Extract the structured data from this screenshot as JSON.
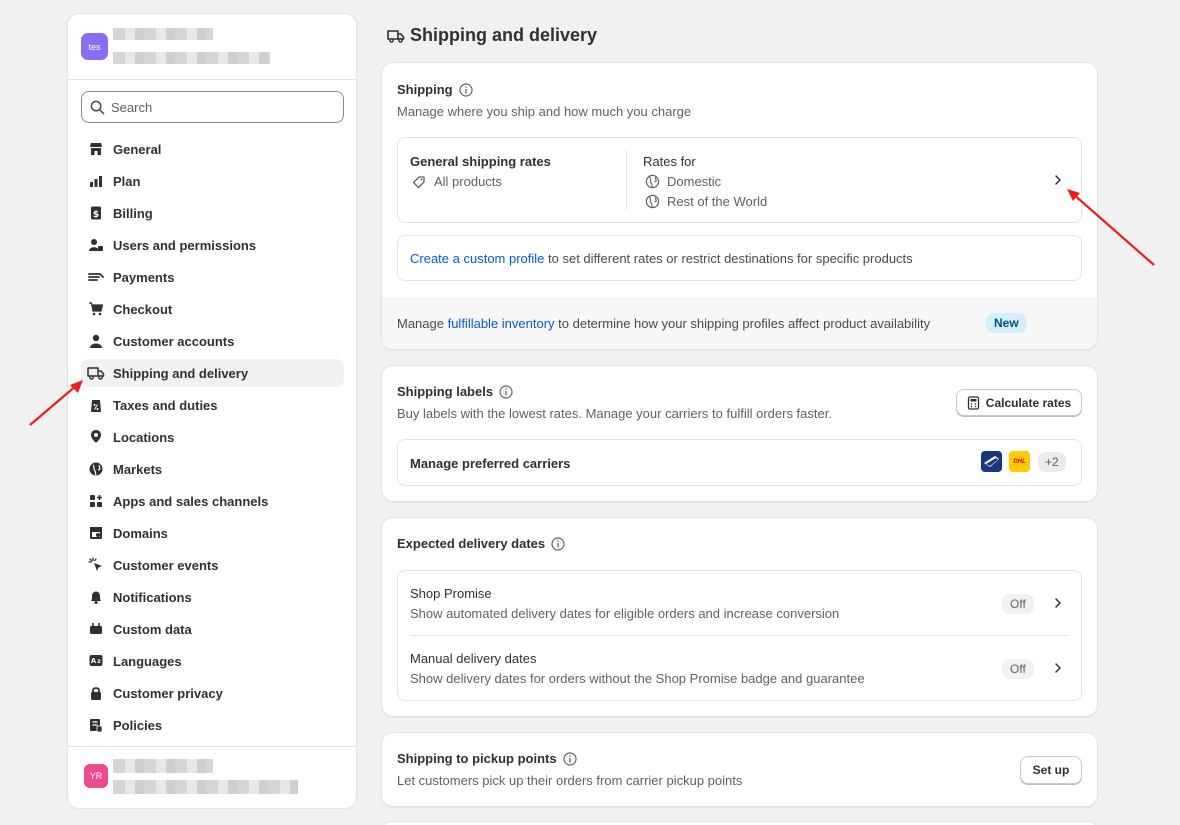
{
  "sidebar": {
    "store_avatar": "tes",
    "search_placeholder": "Search",
    "items": [
      {
        "label": "General",
        "icon": "store-icon"
      },
      {
        "label": "Plan",
        "icon": "plan-icon"
      },
      {
        "label": "Billing",
        "icon": "billing-icon"
      },
      {
        "label": "Users and permissions",
        "icon": "users-icon"
      },
      {
        "label": "Payments",
        "icon": "payments-icon"
      },
      {
        "label": "Checkout",
        "icon": "cart-icon"
      },
      {
        "label": "Customer accounts",
        "icon": "person-icon"
      },
      {
        "label": "Shipping and delivery",
        "icon": "truck-icon",
        "active": true
      },
      {
        "label": "Taxes and duties",
        "icon": "tax-icon"
      },
      {
        "label": "Locations",
        "icon": "location-icon"
      },
      {
        "label": "Markets",
        "icon": "globe-icon"
      },
      {
        "label": "Apps and sales channels",
        "icon": "apps-icon"
      },
      {
        "label": "Domains",
        "icon": "domains-icon"
      },
      {
        "label": "Customer events",
        "icon": "cursor-icon"
      },
      {
        "label": "Notifications",
        "icon": "bell-icon"
      },
      {
        "label": "Custom data",
        "icon": "data-icon"
      },
      {
        "label": "Languages",
        "icon": "language-icon"
      },
      {
        "label": "Customer privacy",
        "icon": "lock-icon"
      },
      {
        "label": "Policies",
        "icon": "policies-icon"
      }
    ],
    "user_avatar": "YR"
  },
  "page": {
    "title": "Shipping and delivery"
  },
  "shipping": {
    "title": "Shipping",
    "subtitle": "Manage where you ship and how much you charge",
    "general_rates_title": "General shipping rates",
    "all_products": "All products",
    "rates_for": "Rates for",
    "domestic": "Domestic",
    "rest_of_world": "Rest of the World",
    "custom_profile_link": "Create a custom profile",
    "custom_profile_text": " to set different rates or restrict destinations for specific products",
    "footer_prefix": "Manage ",
    "footer_link": "fulfillable inventory",
    "footer_suffix": " to determine how your shipping profiles affect product availability",
    "new_badge": "New"
  },
  "labels": {
    "title": "Shipping labels",
    "subtitle": "Buy labels with the lowest rates. Manage your carriers to fulfill orders faster.",
    "calculate_button": "Calculate rates",
    "carriers_label": "Manage preferred carriers",
    "dhl_text": "DHL",
    "more_carriers": "+2"
  },
  "delivery_dates": {
    "title": "Expected delivery dates",
    "rows": [
      {
        "title": "Shop Promise",
        "desc": "Show automated delivery dates for eligible orders and increase conversion",
        "status": "Off"
      },
      {
        "title": "Manual delivery dates",
        "desc": "Show delivery dates for orders without the Shop Promise badge and guarantee",
        "status": "Off"
      }
    ]
  },
  "pickup": {
    "title": "Shipping to pickup points",
    "subtitle": "Let customers pick up their orders from carrier pickup points",
    "setup_button": "Set up"
  },
  "colors": {
    "annotation_arrow": "#e8201a",
    "link": "#005bd3",
    "active_bg": "#f1f1f1"
  }
}
